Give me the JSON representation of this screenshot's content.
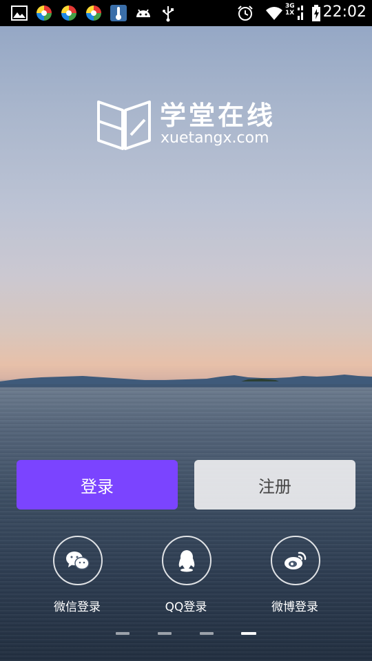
{
  "status_bar": {
    "time": "22:02",
    "network_label_top": "3G",
    "network_label_bottom": "1X",
    "icons": [
      "image-icon",
      "app-icon",
      "app-icon",
      "app-icon",
      "thermometer-icon",
      "android-icon",
      "usb-icon",
      "alarm-icon",
      "wifi-icon",
      "signal-icon",
      "battery-charging-icon"
    ]
  },
  "logo": {
    "name_cn": "学堂在线",
    "domain": "xuetangx.com"
  },
  "actions": {
    "login_label": "登录",
    "register_label": "注册"
  },
  "social_login": [
    {
      "label": "微信登录",
      "icon": "wechat-icon"
    },
    {
      "label": "QQ登录",
      "icon": "qq-icon"
    },
    {
      "label": "微博登录",
      "icon": "weibo-icon"
    }
  ],
  "pager": {
    "total": 4,
    "active": 4
  },
  "colors": {
    "primary": "#7b44ff",
    "secondary_button": "#eeeef0",
    "statusbar": "#000000"
  }
}
